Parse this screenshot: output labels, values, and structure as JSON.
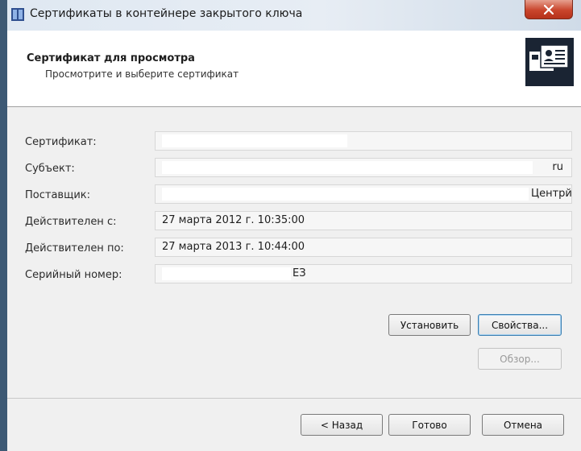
{
  "window": {
    "title": "Сертификаты в контейнере закрытого ключа"
  },
  "header": {
    "title": "Сертификат для просмотра",
    "subtitle": "Просмотрите и выберите сертификат"
  },
  "fields": [
    {
      "label": "Сертификат:",
      "value": ""
    },
    {
      "label": "Субъект:",
      "value": "ru"
    },
    {
      "label": "Поставщик:",
      "value": "Центрй"
    },
    {
      "label": "Действителен с:",
      "value": "27 марта 2012 г. 10:35:00"
    },
    {
      "label": "Действителен по:",
      "value": "27 марта 2013 г. 10:44:00"
    },
    {
      "label": "Серийный номер:",
      "value": "ЕЗ"
    }
  ],
  "buttons": {
    "install": "Установить",
    "properties": "Свойства...",
    "browse": "Обзор...",
    "back": "< Назад",
    "finish": "Готово",
    "cancel": "Отмена"
  }
}
